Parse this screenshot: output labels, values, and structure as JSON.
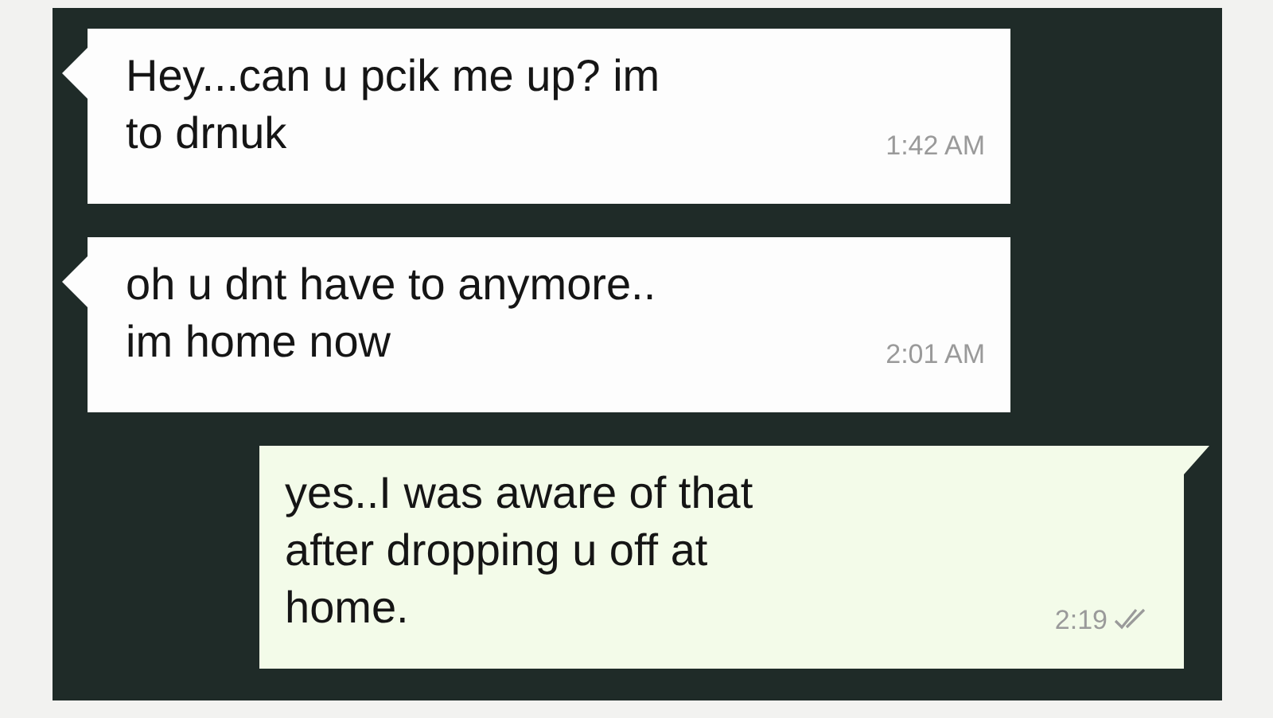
{
  "messages": [
    {
      "kind": "incoming",
      "text": "Hey...can u pcik me up? im\nto drnuk",
      "time": "1:42 AM"
    },
    {
      "kind": "incoming",
      "text": "oh u dnt have to anymore..\nim home now",
      "time": "2:01 AM"
    },
    {
      "kind": "outgoing",
      "text": "yes..I was aware of that\nafter dropping u off at\nhome.",
      "time": "2:19",
      "read": false
    }
  ]
}
